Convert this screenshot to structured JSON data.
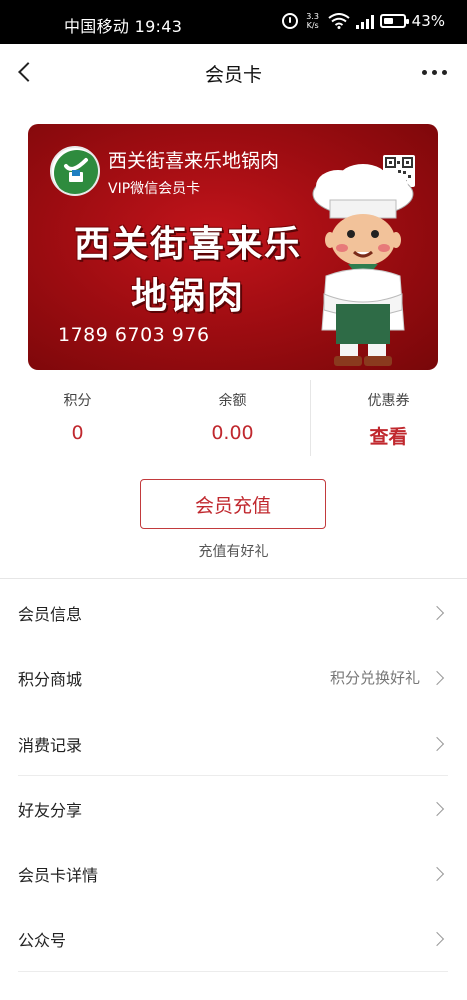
{
  "status_bar": {
    "carrier_time": "中国移动 19:43",
    "net_speed_top": "3.3",
    "net_speed_bottom": "K/s",
    "battery": "43%"
  },
  "header": {
    "title": "会员卡"
  },
  "card": {
    "store_name": "西关街喜来乐地锅肉",
    "card_type": "VIP微信会员卡",
    "brand_line1": "西关街喜来乐",
    "brand_line2": "地锅肉",
    "card_number": "1789 6703 976",
    "colors": {
      "card_red": "#a10d12",
      "accent": "#c0282e"
    }
  },
  "stats": {
    "points_label": "积分",
    "points_value": "0",
    "balance_label": "余额",
    "balance_value": "0.00",
    "coupons_label": "优惠券",
    "coupons_value": "查看"
  },
  "recharge": {
    "button_label": "会员充值",
    "tip": "充值有好礼"
  },
  "menu": {
    "items": [
      {
        "label": "会员信息",
        "right": ""
      },
      {
        "label": "积分商城",
        "right": "积分兑换好礼"
      },
      {
        "label": "消费记录",
        "right": ""
      },
      {
        "label": "好友分享",
        "right": ""
      },
      {
        "label": "会员卡详情",
        "right": ""
      },
      {
        "label": "公众号",
        "right": ""
      }
    ]
  }
}
